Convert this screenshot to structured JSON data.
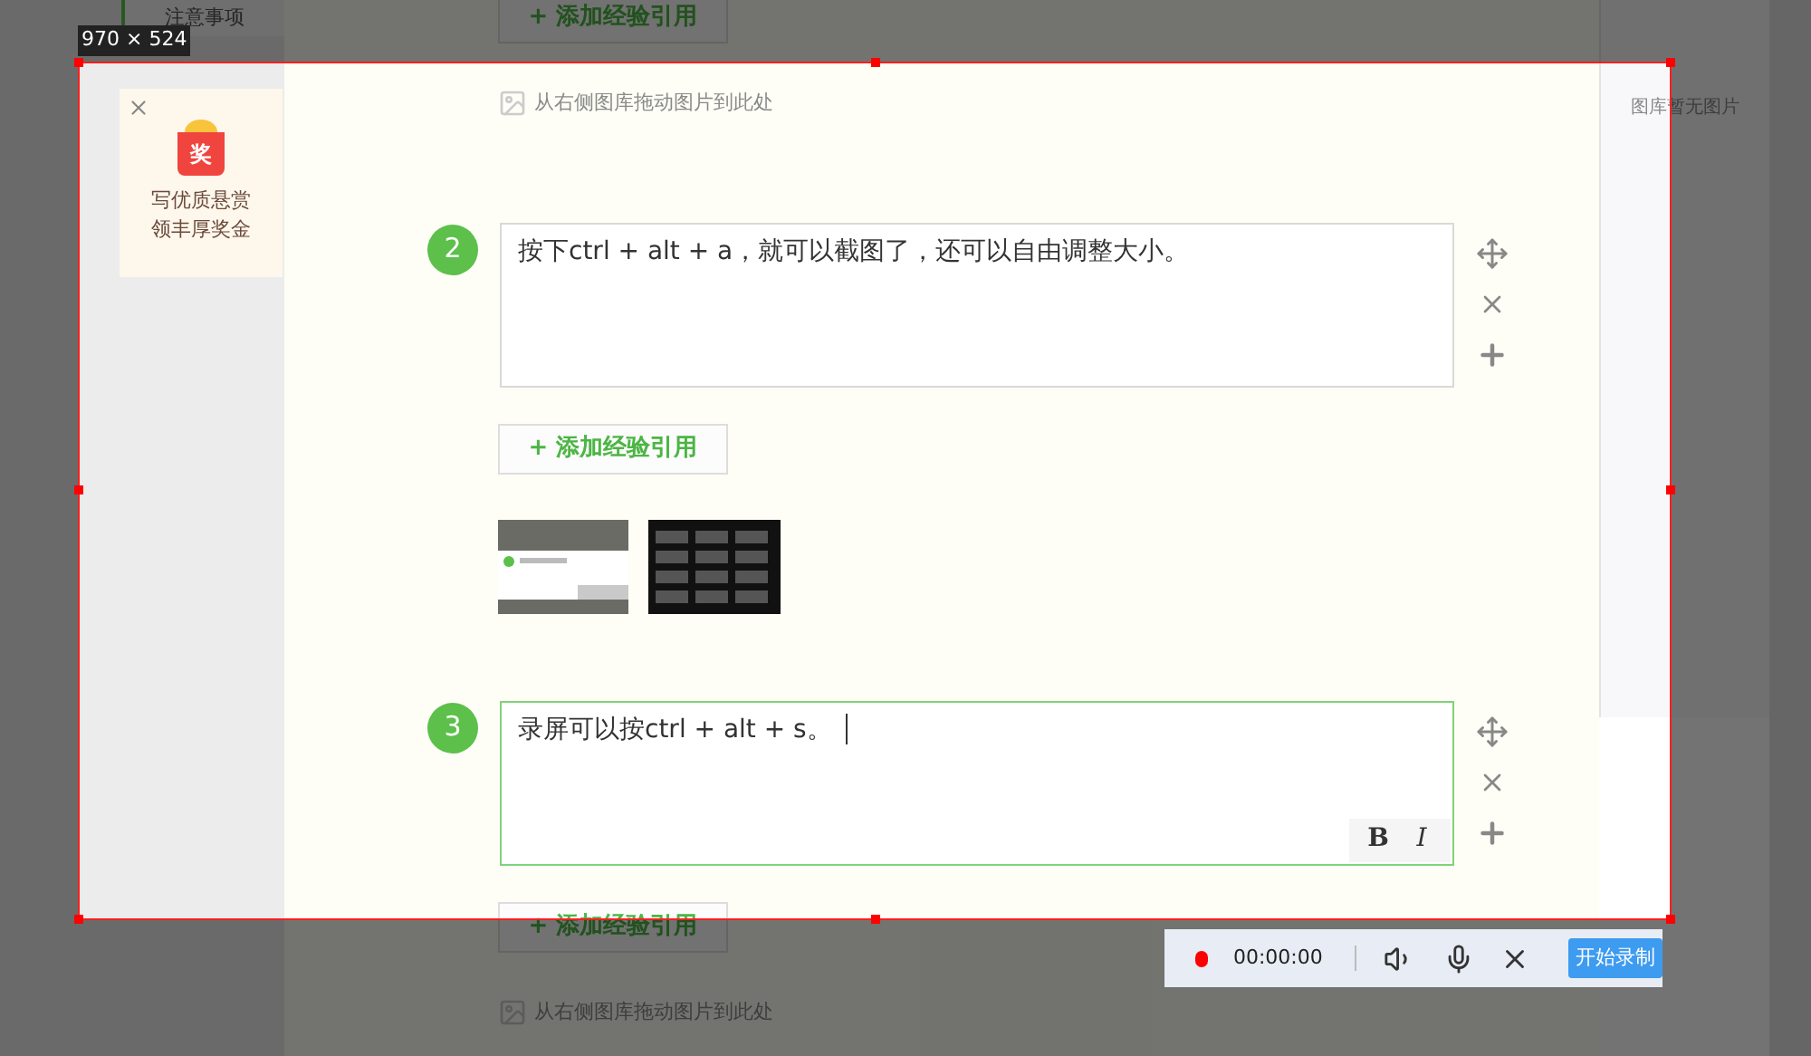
{
  "sidebar": {
    "tab": "注意事项",
    "promo": {
      "badge": "奖",
      "lines": [
        "写优质悬赏",
        "领丰厚奖金"
      ]
    }
  },
  "blocks": [
    {
      "kind": "add_button",
      "label": "+ 添加经验引用"
    },
    {
      "kind": "image_hint",
      "text": "从右侧图库拖动图片到此处"
    },
    {
      "kind": "step",
      "number": "2",
      "text": "按下ctrl + alt + a，就可以截图了，还可以自由调整大小。",
      "focused": false
    },
    {
      "kind": "add_button",
      "label": "+ 添加经验引用"
    },
    {
      "kind": "thumbnails"
    },
    {
      "kind": "step",
      "number": "3",
      "text": "录屏可以按ctrl + alt + s。",
      "focused": true,
      "format_buttons": [
        "B",
        "I"
      ]
    },
    {
      "kind": "add_button",
      "label": "+ 添加经验引用"
    },
    {
      "kind": "image_hint",
      "text": "从右侧图库拖动图片到此处"
    }
  ],
  "gallery": {
    "empty_text": "图库暂无图片"
  },
  "capture": {
    "size_label": "970 × 524"
  },
  "recorder": {
    "time": "00:00:00",
    "start_button": "开始录制"
  }
}
